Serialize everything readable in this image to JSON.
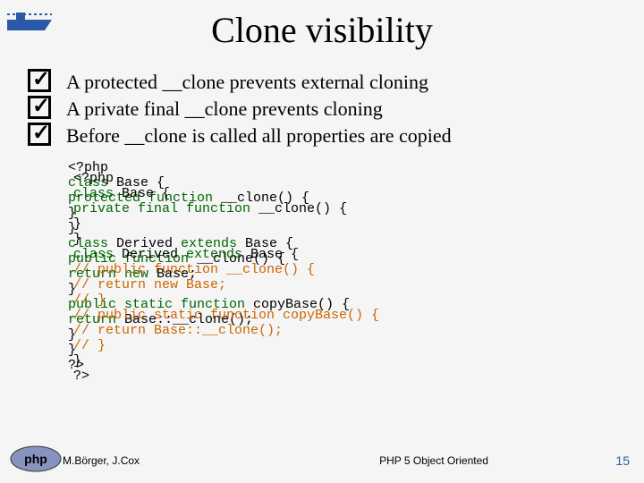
{
  "title": "Clone visibility",
  "bullets": [
    "A protected __clone prevents external cloning",
    "A private final __clone prevents cloning",
    "Before __clone is called all properties are copied"
  ],
  "code_layer1": {
    "l1": "<?php",
    "l2a": "class",
    "l2b": " Base {",
    "l3a": "  protected function",
    "l3b": " __clone() {",
    "l4": "  }",
    "l5": "}",
    "l6a": "class",
    "l6b": " Derived ",
    "l6c": "extends",
    "l6d": " Base {",
    "l7a": "  public function",
    "l7b": " __clone() {",
    "l8a": "    return new",
    "l8b": " Base;",
    "l9": "  } ",
    "l10a": "  public static function",
    "l10b": " copyBase() {",
    "l11a": "    return",
    "l11b": " Base::__clone();",
    "l12": "  }",
    "l13": "}",
    "l14": "?>"
  },
  "code_layer2": {
    "l1": "<?php",
    "l2a": "class",
    "l2b": " Base {",
    "l3a": "  private final function",
    "l3b": " __clone() {",
    "l4": "  }",
    "l5": "}",
    "l6a": "class",
    "l6b": " Derived ",
    "l6c": "extends",
    "l6d": " Base {",
    "l7": "  // public function __clone() {",
    "l8": "  //   return new Base;",
    "l9": "  // } ",
    "l10": "  // public static function copyBase() {",
    "l11": "  //   return Base::__clone();",
    "l12": "  // }",
    "l13": "}",
    "l14": "?>"
  },
  "footer": {
    "left": "M.Börger, J.Cox",
    "center": "PHP 5 Object Oriented",
    "right": "15"
  }
}
